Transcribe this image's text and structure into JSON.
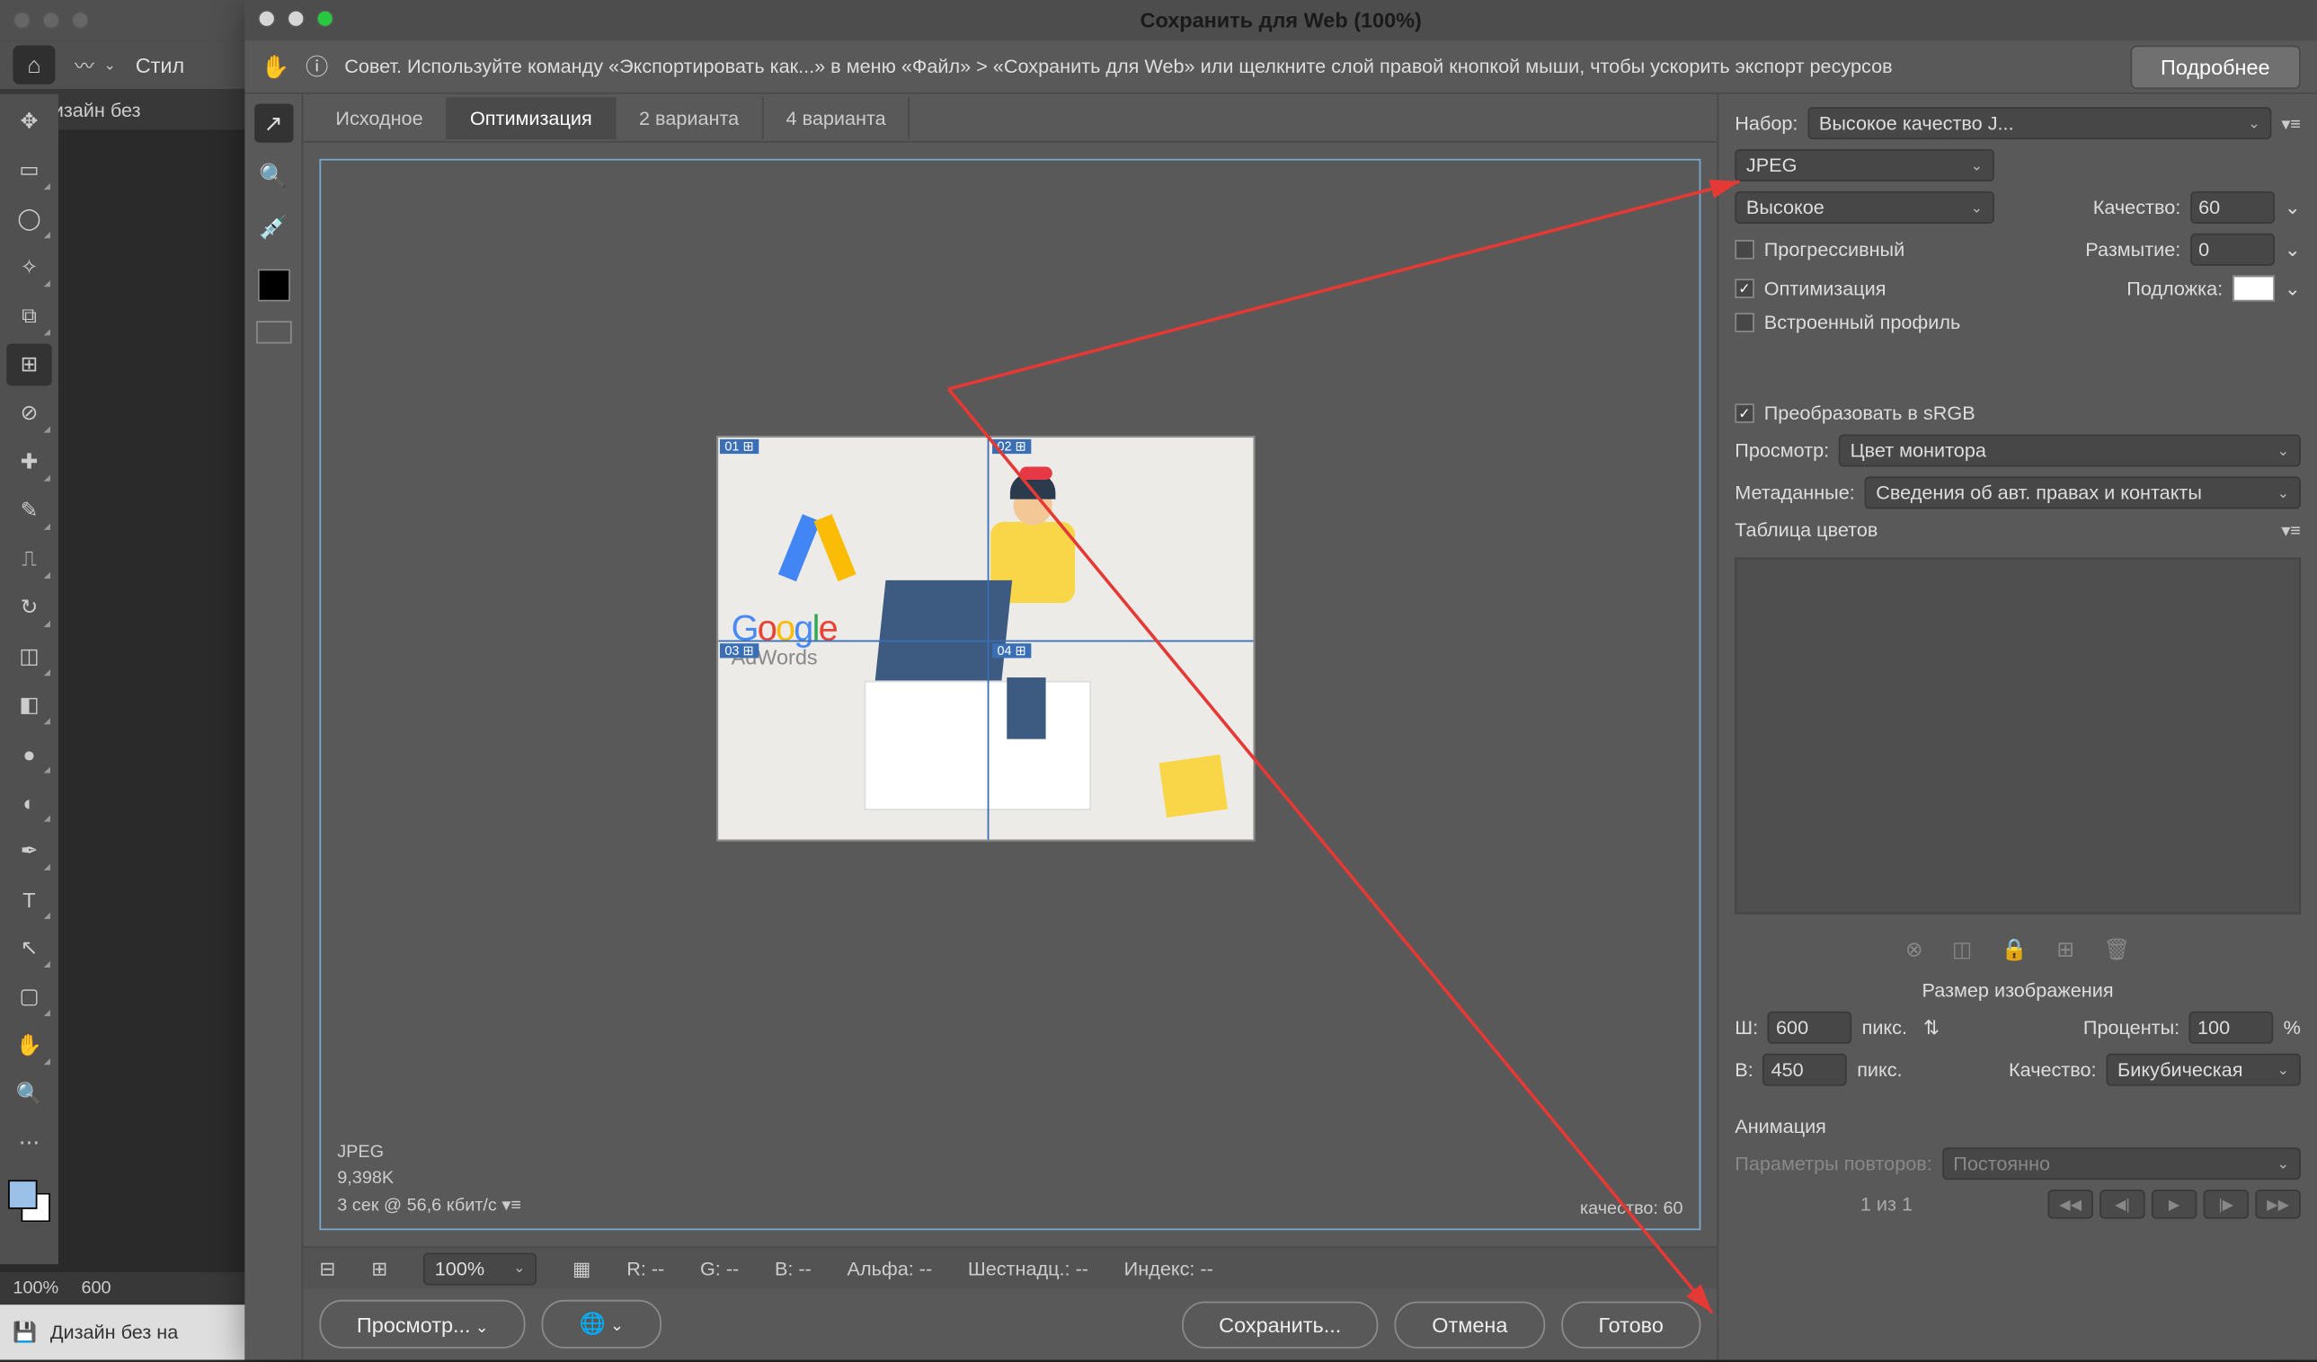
{
  "host": {
    "style_label": "Стил",
    "doc_tab": "Дизайн без",
    "zoom": "100%",
    "dim": "600 ",
    "status_file": "Дизайн без на"
  },
  "dialog": {
    "title": "Сохранить для Web (100%)",
    "tip": "Совет. Используйте команду «Экспортировать как...» в меню «Файл» > «Сохранить для Web» или щелкните слой правой кнопкой мыши, чтобы ускорить экспорт ресурсов",
    "more": "Подробнее"
  },
  "tabs": {
    "t1": "Исходное",
    "t2": "Оптимизация",
    "t3": "2 варианта",
    "t4": "4 варианта"
  },
  "footer": {
    "format": "JPEG",
    "size": "9,398K",
    "time": "3 сек @ 56,6 кбит/с",
    "quality": "качество: 60"
  },
  "right": {
    "preset_label": "Набор:",
    "preset": "Высокое качество J...",
    "format": "JPEG",
    "quality_sel": "Высокое",
    "quality_label": "Качество:",
    "quality_val": "60",
    "progressive": "Прогрессивный",
    "blur_label": "Размытие:",
    "blur_val": "0",
    "optimized": "Оптимизация",
    "matte_label": "Подложка:",
    "embed": "Встроенный профиль",
    "srgb": "Преобразовать в sRGB",
    "preview_label": "Просмотр:",
    "preview": "Цвет монитора",
    "meta_label": "Метаданные:",
    "meta": "Сведения об авт. правах и контакты",
    "ct_title": "Таблица цветов",
    "size_title": "Размер изображения",
    "w_label": "Ш:",
    "w": "600",
    "h_label": "В:",
    "h": "450",
    "px": "пикс.",
    "pct_label": "Проценты:",
    "pct": "100",
    "qmethod_label": "Качество:",
    "qmethod": "Бикубическая",
    "anim": "Анимация",
    "loop_label": "Параметры повторов:",
    "loop": "Постоянно",
    "frame": "1 из 1"
  },
  "status": {
    "zoom": "100%",
    "r": "R: --",
    "g": "G: --",
    "b": "B: --",
    "alpha": "Альфа: --",
    "hex": "Шестнадц.: --",
    "idx": "Индекс: --"
  },
  "buttons": {
    "preview": "Просмотр...",
    "save": "Сохранить...",
    "cancel": "Отмена",
    "done": "Готово"
  },
  "illust": {
    "google": "Google",
    "adwords": "AdWords"
  }
}
